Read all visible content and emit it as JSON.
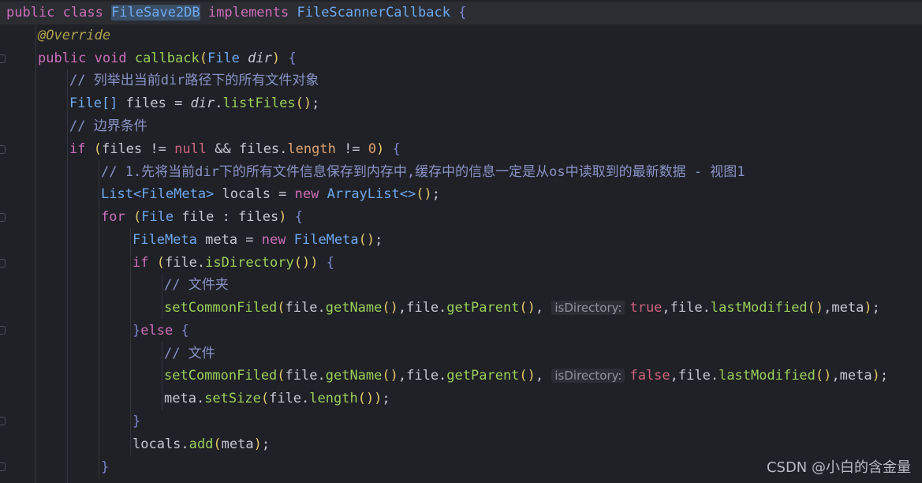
{
  "code": {
    "line1": {
      "kw": "public class ",
      "cls": "FileSave2DB",
      "kw2": " implements ",
      "iface": "FileScannerCallback",
      "brace": " {"
    },
    "line2": {
      "ann": "@Override"
    },
    "line3": {
      "kw": "public void ",
      "fn": "callback",
      "p1": "(",
      "cls": "File ",
      "param": "dir",
      "p2": ")",
      "brace": " {"
    },
    "line4": {
      "comment": "// 列举出当前dir路径下的所有文件对象"
    },
    "line5": {
      "cls": "File[]",
      "t1": " files = ",
      "it": "dir",
      "t2": ".",
      "fn": "listFiles",
      "p": "()",
      "t3": ";"
    },
    "line6": {
      "comment": "// 边界条件"
    },
    "line7": {
      "kw": "if",
      "p1": " (",
      "t1": "files != ",
      "lit": "null",
      "t2": " && files.",
      "fld": "length",
      "t3": " != ",
      "num": "0",
      "p2": ")",
      "brace": " {"
    },
    "line8": {
      "comment": "// 1.先将当前dir下的所有文件信息保存到内存中,缓存中的信息一定是从os中读取到的最新数据 - 视图1"
    },
    "line9": {
      "cls": "List<FileMeta>",
      "t1": " locals = ",
      "kw": "new",
      "cls2": " ArrayList<>",
      "p": "()",
      "t2": ";"
    },
    "line10": {
      "kw": "for",
      "p1": " (",
      "cls": "File",
      "t1": " file : files",
      "p2": ")",
      "brace": " {"
    },
    "line11": {
      "cls": "FileMeta",
      "t1": " meta = ",
      "kw": "new",
      "cls2": " FileMeta",
      "p": "()",
      "t2": ";"
    },
    "line12": {
      "kw": "if",
      "p1": " (",
      "t1": "file.",
      "fn": "isDirectory",
      "p2": "())",
      "brace": " {"
    },
    "line13": {
      "comment": "// 文件夹"
    },
    "line14": {
      "fn": "setCommonFiled",
      "p1": "(",
      "t1": "file.",
      "fn2": "getName",
      "p2": "()",
      "t2": ",file.",
      "fn3": "getParent",
      "p3": "()",
      "t3": ", ",
      "hint": "isDirectory:",
      "lit": "true",
      "t4": ",file.",
      "fn4": "lastModified",
      "p4": "()",
      "t5": ",meta",
      "p5": ")",
      "t6": ";"
    },
    "line15": {
      "brace": "}",
      "kw": "else",
      "brace2": " {"
    },
    "line16": {
      "comment": "// 文件"
    },
    "line17": {
      "fn": "setCommonFiled",
      "p1": "(",
      "t1": "file.",
      "fn2": "getName",
      "p2": "()",
      "t2": ",file.",
      "fn3": "getParent",
      "p3": "()",
      "t3": ", ",
      "hint": "isDirectory:",
      "lit": "false",
      "t4": ",file.",
      "fn4": "lastModified",
      "p4": "()",
      "t5": ",meta",
      "p5": ")",
      "t6": ";"
    },
    "line18": {
      "t1": "meta.",
      "fn": "setSize",
      "p1": "(",
      "t2": "file.",
      "fn2": "length",
      "p2": "())",
      "t3": ";"
    },
    "line19": {
      "brace": "}"
    },
    "line20": {
      "t1": "locals.",
      "fn": "add",
      "p1": "(",
      "t2": "meta",
      "p2": ")",
      "t3": ";"
    },
    "line21": {
      "brace": "}"
    }
  },
  "watermark": "CSDN @小白的含金量",
  "colors": {
    "background": "#1f2126",
    "keyword": "#cc6fb9",
    "class": "#6fa8ee",
    "function": "#9ccf5a",
    "comment": "#8a93c7",
    "paren": "#e2c86a",
    "brace": "#7c86cf",
    "literal": "#d1637d",
    "number": "#e0a370",
    "annotation": "#b0a34c"
  }
}
